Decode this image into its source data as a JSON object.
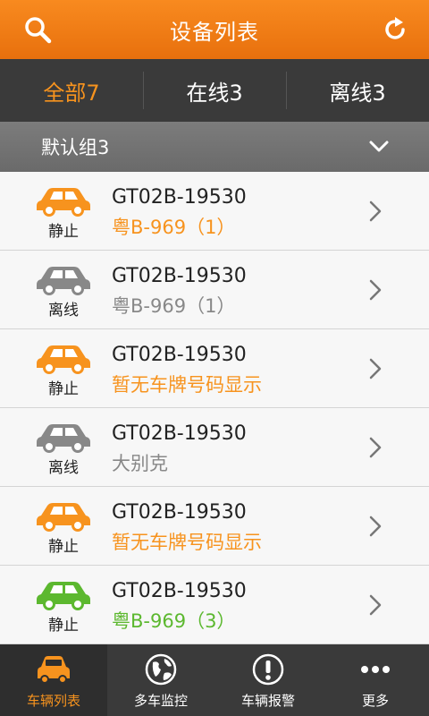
{
  "header": {
    "title": "设备列表"
  },
  "tabs": [
    {
      "label": "全部7",
      "active": true
    },
    {
      "label": "在线3",
      "active": false
    },
    {
      "label": "离线3",
      "active": false
    }
  ],
  "group": {
    "label": "默认组3"
  },
  "colors": {
    "orange": "#f7931e",
    "gray": "#888888",
    "green": "#5cb82f",
    "accent": "#f08415"
  },
  "rows": [
    {
      "state": "静止",
      "code": "GT02B-19530",
      "sub": "粤B-969（1）",
      "color": "orange"
    },
    {
      "state": "离线",
      "code": "GT02B-19530",
      "sub": "粤B-969（1）",
      "color": "gray"
    },
    {
      "state": "静止",
      "code": "GT02B-19530",
      "sub": "暂无车牌号码显示",
      "color": "orange"
    },
    {
      "state": "离线",
      "code": "GT02B-19530",
      "sub": "大别克",
      "color": "gray"
    },
    {
      "state": "静止",
      "code": "GT02B-19530",
      "sub": "暂无车牌号码显示",
      "color": "orange"
    },
    {
      "state": "静止",
      "code": "GT02B-19530",
      "sub": "粤B-969（3）",
      "color": "green"
    }
  ],
  "bottom_nav": [
    {
      "label": "车辆列表",
      "icon": "car-icon",
      "active": true
    },
    {
      "label": "多车监控",
      "icon": "globe-icon",
      "active": false
    },
    {
      "label": "车辆报警",
      "icon": "alert-icon",
      "active": false
    },
    {
      "label": "更多",
      "icon": "more-icon",
      "active": false
    }
  ]
}
